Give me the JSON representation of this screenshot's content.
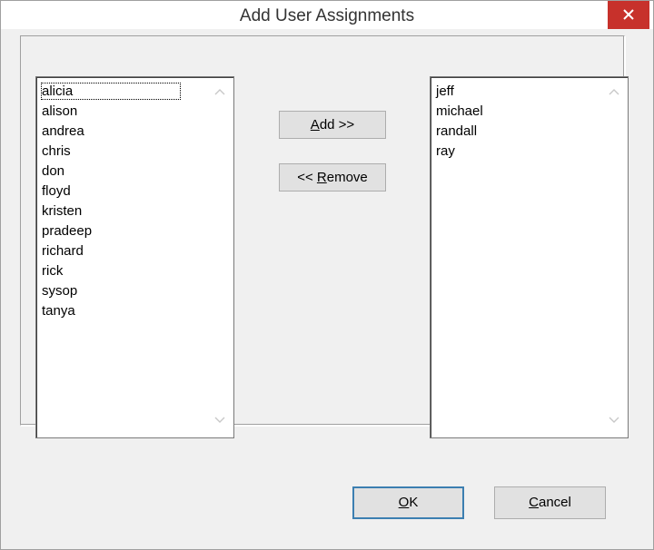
{
  "window": {
    "title": "Add User Assignments"
  },
  "available_users": {
    "items": [
      "alicia",
      "alison",
      "andrea",
      "chris",
      "don",
      "floyd",
      "kristen",
      "pradeep",
      "richard",
      "rick",
      "sysop",
      "tanya"
    ],
    "focused": "alicia"
  },
  "assigned_users": {
    "items": [
      "jeff",
      "michael",
      "randall",
      "ray"
    ]
  },
  "buttons": {
    "add": {
      "mnemonic": "A",
      "rest": "dd >>"
    },
    "remove": {
      "prefix": "<< ",
      "mnemonic": "R",
      "rest": "emove"
    },
    "ok": {
      "mnemonic": "O",
      "rest": "K"
    },
    "cancel": {
      "mnemonic": "C",
      "rest": "ancel"
    }
  },
  "icons": {
    "close": "close-icon",
    "scroll_up": "chevron-up-icon",
    "scroll_down": "chevron-down-icon"
  },
  "colors": {
    "close_button": "#c7312b",
    "focus_button_border": "#3c7fb1"
  }
}
